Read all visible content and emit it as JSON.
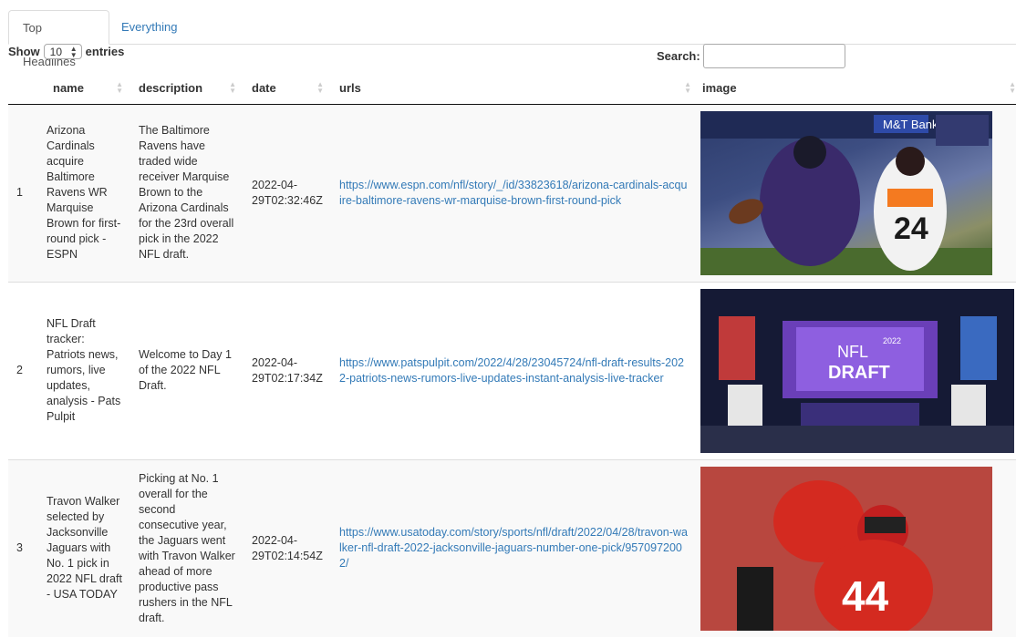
{
  "tabs": [
    {
      "label": "Top Headlines",
      "active": true
    },
    {
      "label": "Everything",
      "active": false
    }
  ],
  "length_control": {
    "prefix": "Show",
    "value": "10",
    "suffix": "entries"
  },
  "search": {
    "label": "Search:",
    "value": ""
  },
  "columns": [
    "name",
    "description",
    "date",
    "urls",
    "image"
  ],
  "rows": [
    {
      "index": "1",
      "name": "Arizona Cardinals acquire Baltimore Ravens WR Marquise Brown for first-round pick - ESPN",
      "description": "The Baltimore Ravens have traded wide receiver Marquise Brown to the Arizona Cardinals for the 23rd overall pick in the 2022 NFL draft.",
      "date": "2022-04-29T02:32:46Z",
      "url": "https://www.espn.com/nfl/story/_/id/33823618/arizona-cardinals-acquire-baltimore-ravens-wr-marquise-brown-first-round-pick",
      "image": "football-catch-photo"
    },
    {
      "index": "2",
      "name": "NFL Draft tracker: Patriots news, rumors, live updates, analysis - Pats Pulpit",
      "description": "Welcome to Day 1 of the 2022 NFL Draft.",
      "date": "2022-04-29T02:17:34Z",
      "url": "https://www.patspulpit.com/2022/4/28/23045724/nfl-draft-results-2022-patriots-news-rumors-live-updates-instant-analysis-live-tracker",
      "image": "nfl-draft-stage-photo"
    },
    {
      "index": "3",
      "name": "Travon Walker selected by Jacksonville Jaguars with No. 1 pick in 2022 NFL draft - USA TODAY",
      "description": "Picking at No. 1 overall for the second consecutive year, the Jaguars went with Travon Walker ahead of more productive pass rushers in the NFL draft.",
      "date": "2022-04-29T02:14:54Z",
      "url": "https://www.usatoday.com/story/sports/nfl/draft/2022/04/28/travon-walker-nfl-draft-2022-jacksonville-jaguars-number-one-pick/9570972002/",
      "image": "georgia-player-photo"
    }
  ],
  "image_text": {
    "banner1": "M&T Bank",
    "jersey_cincy": "24",
    "draft_logo_line1": "NFL",
    "draft_logo_line2": "DRAFT",
    "draft_year": "2022",
    "jersey_uga": "44"
  },
  "colors": {
    "link": "#337ab7",
    "row_stripe": "#f9f9f9",
    "header_border": "#111111"
  }
}
